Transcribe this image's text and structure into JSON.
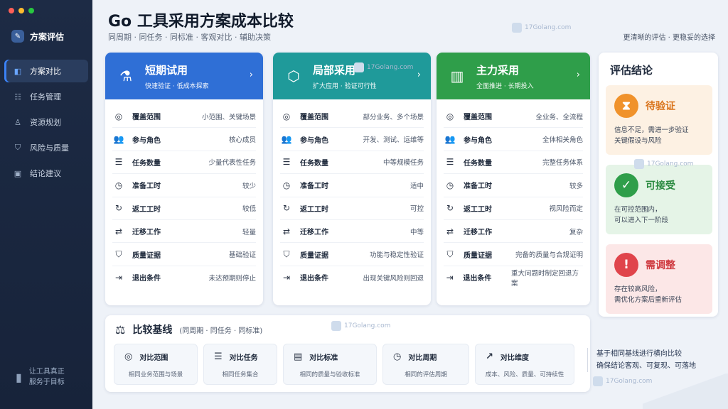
{
  "app": {
    "name": "方案评估"
  },
  "sidebar": {
    "items": [
      {
        "label": "方案对比",
        "icon": "compare-icon",
        "active": true
      },
      {
        "label": "任务管理",
        "icon": "task-list-icon",
        "active": false
      },
      {
        "label": "资源规划",
        "icon": "user-icon",
        "active": false
      },
      {
        "label": "风险与质量",
        "icon": "shield-icon",
        "active": false
      },
      {
        "label": "结论建议",
        "icon": "briefcase-icon",
        "active": false
      }
    ],
    "footer": {
      "line1": "让工具真正",
      "line2": "服务于目标"
    }
  },
  "header": {
    "title": "Go 工具采用方案成本比较",
    "subtitle": "同周期 · 同任务 · 同标准 · 客观对比 · 辅助决策",
    "tagline": "更清晰的评估 · 更稳妥的选择"
  },
  "row_labels": [
    "覆盖范围",
    "参与角色",
    "任务数量",
    "准备工时",
    "返工工时",
    "迁移工作",
    "质量证据",
    "退出条件"
  ],
  "row_icons": [
    "target-icon",
    "people-icon",
    "list-icon",
    "clock-icon",
    "refresh-icon",
    "swap-icon",
    "shield-check-icon",
    "exit-icon"
  ],
  "plans": [
    {
      "title": "短期试用",
      "subtitle": "快速验证 · 低成本探索",
      "icon": "flask-icon",
      "color": "#2f6fd6",
      "values": [
        "小范围、关键场景",
        "核心成员",
        "少量代表性任务",
        "较少",
        "较低",
        "轻量",
        "基础验证",
        "未达预期则停止"
      ]
    },
    {
      "title": "局部采用",
      "subtitle": "扩大应用 · 验证可行性",
      "icon": "cube-icon",
      "color": "#1f9a9a",
      "values": [
        "部分业务、多个场景",
        "开发、测试、运维等",
        "中等规模任务",
        "适中",
        "可控",
        "中等",
        "功能与稳定性验证",
        "出现关键风险则回退"
      ]
    },
    {
      "title": "主力采用",
      "subtitle": "全面推进 · 长期投入",
      "icon": "bar-chart-icon",
      "color": "#2f9e4a",
      "values": [
        "全业务、全流程",
        "全体相关角色",
        "完整任务体系",
        "较多",
        "视风险而定",
        "复杂",
        "完备的质量与合规证明",
        "重大问题时制定回退方案"
      ]
    }
  ],
  "verdict": {
    "title": "评估结论",
    "items": [
      {
        "name": "待验证",
        "line1": "信息不足，需进一步验证",
        "line2": "关键假设与风险",
        "icon": "hourglass-icon",
        "color": "#f0922b",
        "bg": "#fdf1e3",
        "text": "#d9731a"
      },
      {
        "name": "可接受",
        "line1": "在可控范围内，",
        "line2": "可以进入下一阶段",
        "icon": "check-icon",
        "color": "#2f9e4a",
        "bg": "#e5f4e7",
        "text": "#2a8a40"
      },
      {
        "name": "需调整",
        "line1": "存在较高风险，",
        "line2": "需优化方案后重新评估",
        "icon": "alert-icon",
        "color": "#e0444b",
        "bg": "#fce7e7",
        "text": "#cf3a40"
      }
    ]
  },
  "baseline": {
    "title": "比较基线",
    "subtitle": "(同周期 · 同任务 · 同标准)",
    "items": [
      {
        "label": "对比范围",
        "sub": "相同业务范围与场景",
        "icon": "target-icon"
      },
      {
        "label": "对比任务",
        "sub": "相同任务集合",
        "icon": "list-icon"
      },
      {
        "label": "对比标准",
        "sub": "相同的质量与验收标准",
        "icon": "document-icon"
      },
      {
        "label": "对比周期",
        "sub": "相同的评估周期",
        "icon": "clock-icon"
      },
      {
        "label": "对比维度",
        "sub": "成本、风险、质量、可持续性",
        "icon": "trend-icon"
      }
    ],
    "note_line1": "基于相同基线进行横向比较",
    "note_line2": "确保结论客观、可复现、可落地"
  },
  "watermark": "17Golang.com"
}
